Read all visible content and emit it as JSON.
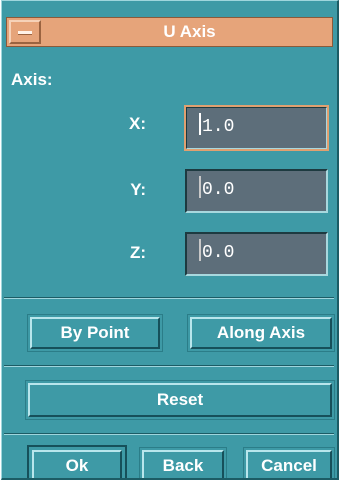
{
  "window": {
    "title": "U Axis"
  },
  "axis": {
    "section_label": "Axis:",
    "x_label": "X:",
    "x_value": "1.0",
    "y_label": "Y:",
    "y_value": "0.0",
    "z_label": "Z:",
    "z_value": "0.0"
  },
  "buttons": {
    "by_point": "By Point",
    "along_axis": "Along Axis",
    "reset": "Reset",
    "ok": "Ok",
    "back": "Back",
    "cancel": "Cancel"
  },
  "colors": {
    "panel": "#3e9aa6",
    "titlebar": "#e6a47a",
    "field": "#5d6e7a"
  }
}
